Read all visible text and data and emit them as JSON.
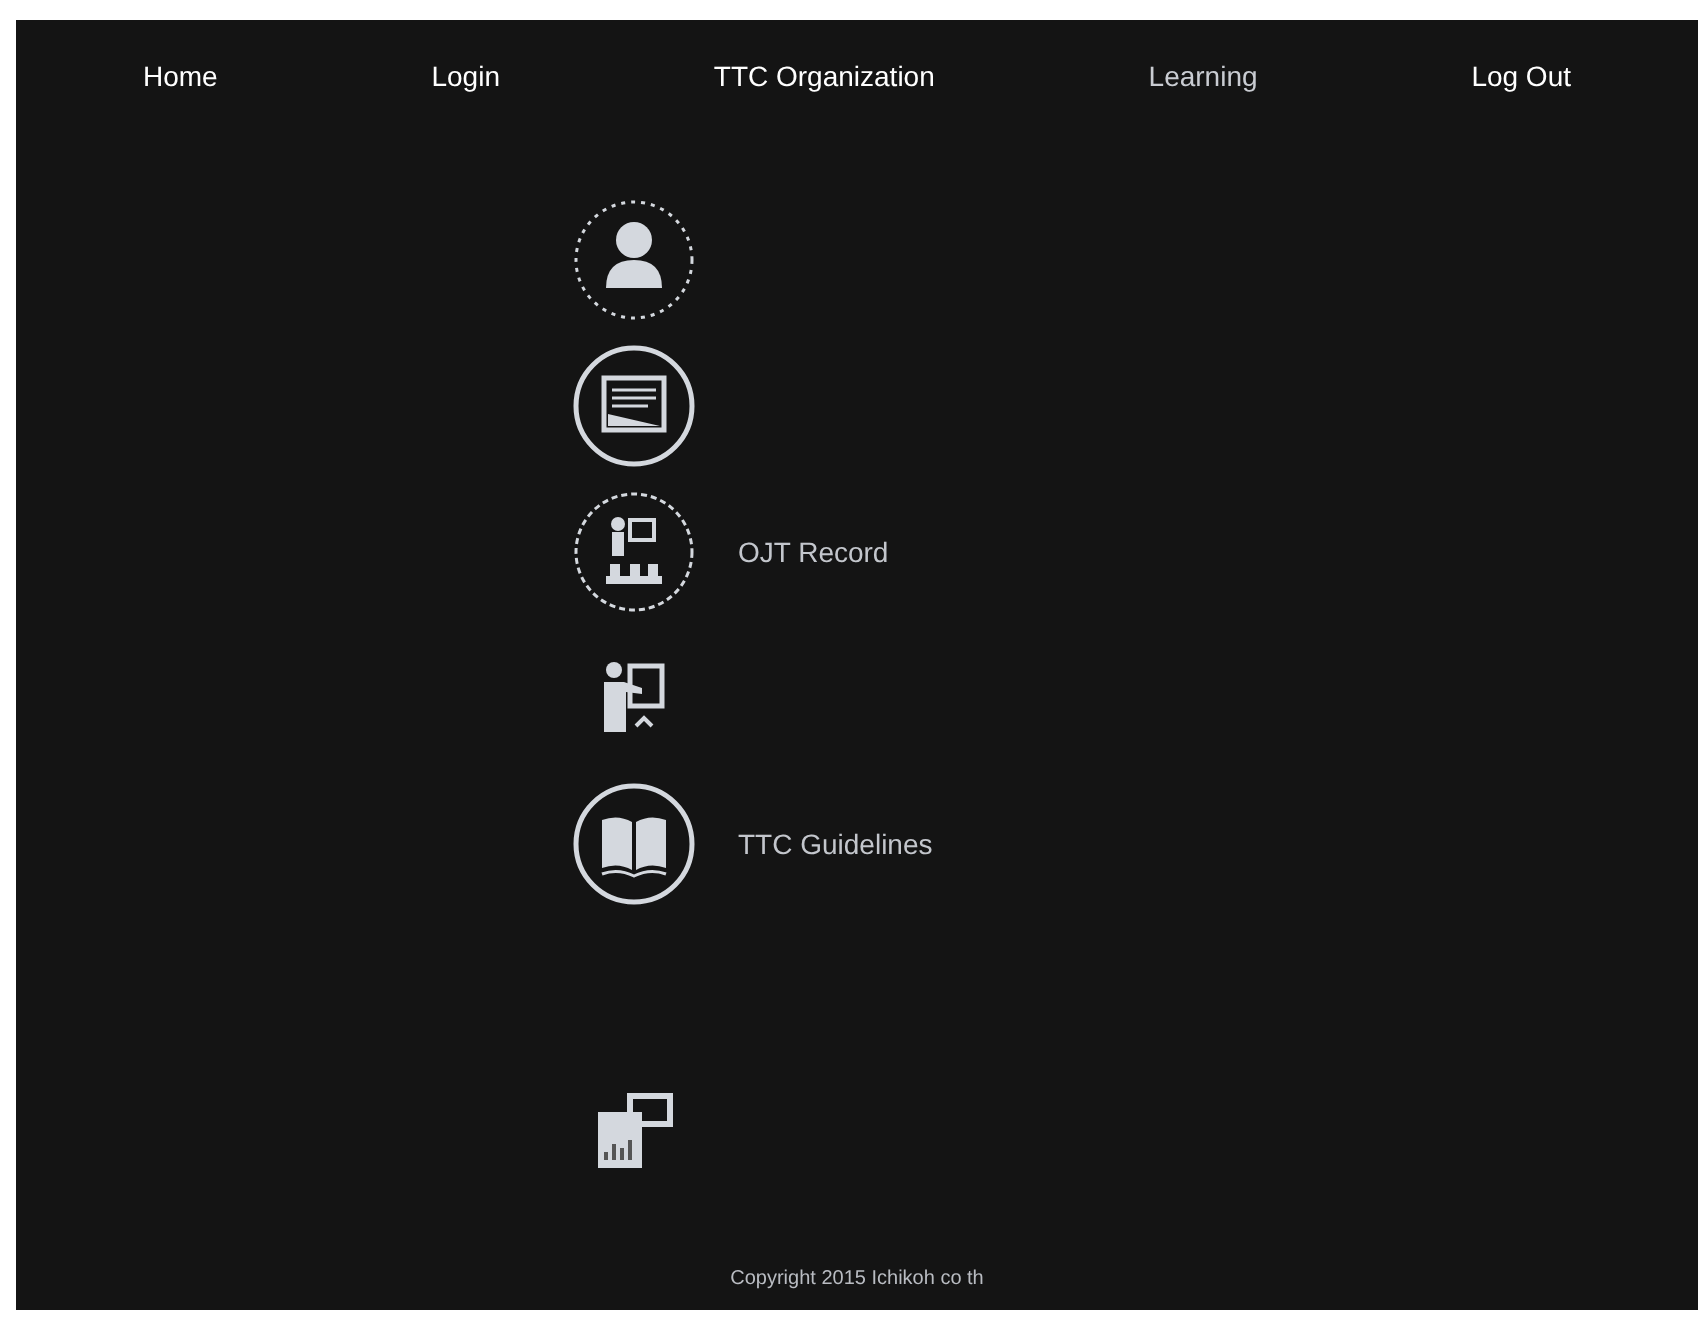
{
  "nav": [
    {
      "label": "Home",
      "selected": false
    },
    {
      "label": "Login",
      "selected": false
    },
    {
      "label": "TTC Organization",
      "selected": false
    },
    {
      "label": "Learning",
      "selected": true
    },
    {
      "label": "Log Out",
      "selected": false
    }
  ],
  "menu_items": [
    {
      "kind": "icon"
    },
    {
      "kind": "icon"
    },
    {
      "kind": "link",
      "label": "OJT Record"
    },
    {
      "kind": "icon"
    },
    {
      "kind": "link",
      "label": "TTC Guidelines"
    },
    {
      "kind": "blank"
    },
    {
      "kind": "icon"
    }
  ],
  "footer": "Copyright 2015  Ichikoh co th"
}
